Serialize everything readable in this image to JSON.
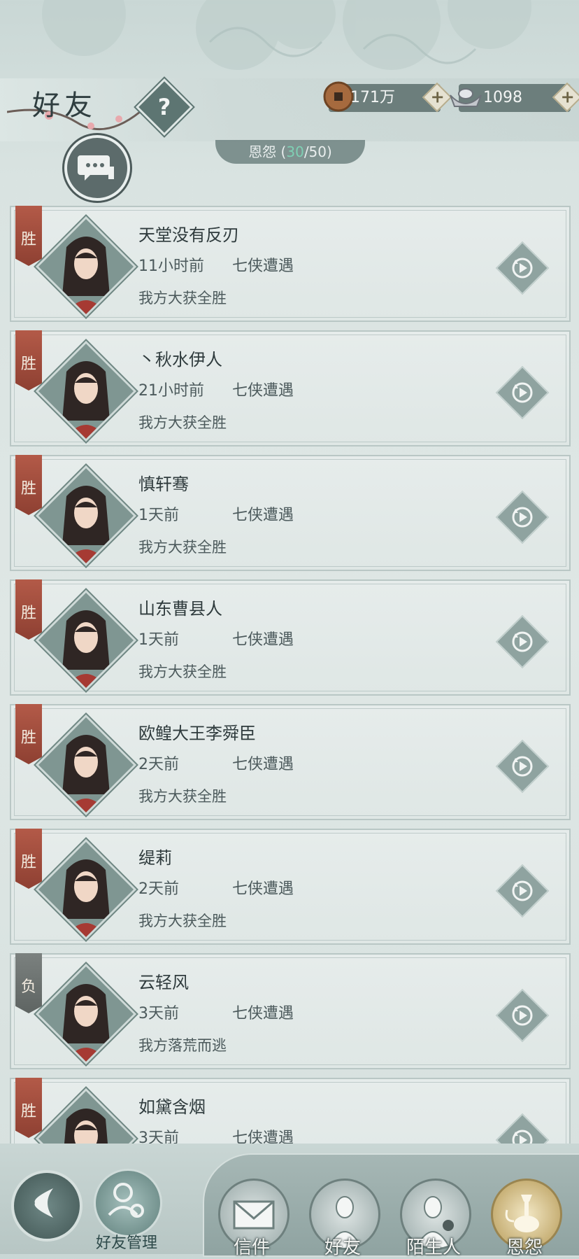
{
  "header": {
    "title": "好友",
    "help_label": "?"
  },
  "currency": {
    "coins": "171万",
    "silver": "1098"
  },
  "tab_header": {
    "label": "恩怨",
    "open_paren": " (",
    "current": "30",
    "total": "/50)"
  },
  "colors": {
    "win_banner": "#a34e3e",
    "lose_banner": "#6e7472",
    "enmity_count": "#7ed0b4"
  },
  "records": [
    {
      "result_badge": "胜",
      "name": "天堂没有反刃",
      "time": "11小时前",
      "mode": "七侠遭遇",
      "result": "我方大获全胜"
    },
    {
      "result_badge": "胜",
      "name": "丶秋水伊人",
      "time": "21小时前",
      "mode": "七侠遭遇",
      "result": "我方大获全胜"
    },
    {
      "result_badge": "胜",
      "name": "慎轩骞",
      "time": "1天前",
      "mode": "七侠遭遇",
      "result": "我方大获全胜"
    },
    {
      "result_badge": "胜",
      "name": "山东曹县人",
      "time": "1天前",
      "mode": "七侠遭遇",
      "result": "我方大获全胜"
    },
    {
      "result_badge": "胜",
      "name": "欧鳇大王李舜臣",
      "time": "2天前",
      "mode": "七侠遭遇",
      "result": "我方大获全胜"
    },
    {
      "result_badge": "胜",
      "name": "缇莉",
      "time": "2天前",
      "mode": "七侠遭遇",
      "result": "我方大获全胜"
    },
    {
      "result_badge": "负",
      "name": "云轻风",
      "time": "3天前",
      "mode": "七侠遭遇",
      "result": "我方落荒而逃"
    },
    {
      "result_badge": "胜",
      "name": "如黛含烟",
      "time": "3天前",
      "mode": "七侠遭遇",
      "result": ""
    }
  ],
  "bottom_nav": {
    "manage_label": "好友管理",
    "tabs": [
      {
        "label": "信件",
        "icon": "envelope-icon"
      },
      {
        "label": "好友",
        "icon": "friend-portrait-icon"
      },
      {
        "label": "陌生人",
        "icon": "stranger-portrait-icon"
      },
      {
        "label": "恩怨",
        "icon": "hookah-icon"
      }
    ]
  }
}
